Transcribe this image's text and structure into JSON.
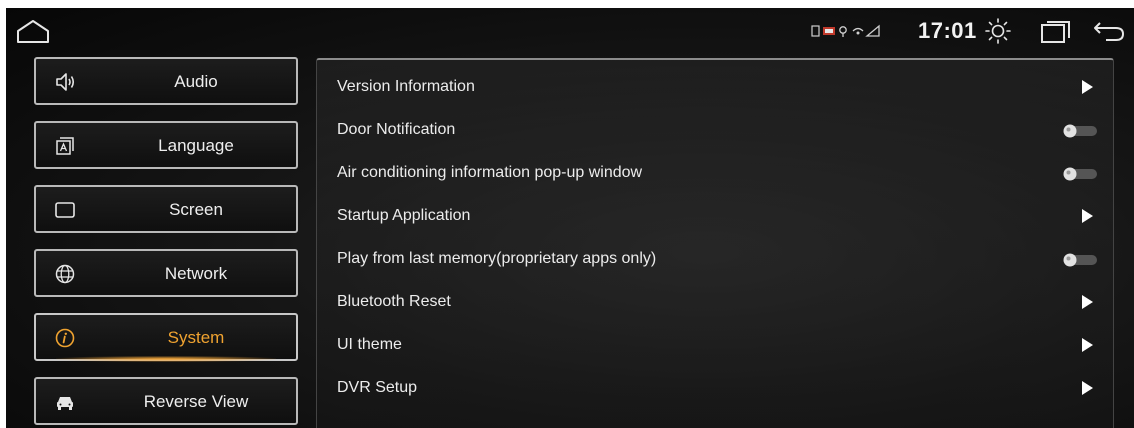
{
  "status_bar": {
    "time": "17:01",
    "icons": [
      "home-icon",
      "sd-card-icon",
      "usb-icon",
      "location-icon",
      "signal-icon",
      "brightness-icon",
      "recent-apps-icon",
      "back-icon"
    ]
  },
  "sidebar": {
    "items": [
      {
        "label": "Audio",
        "icon": "speaker-icon",
        "active": false
      },
      {
        "label": "Language",
        "icon": "language-icon",
        "active": false
      },
      {
        "label": "Screen",
        "icon": "screen-icon",
        "active": false
      },
      {
        "label": "Network",
        "icon": "globe-icon",
        "active": false
      },
      {
        "label": "System",
        "icon": "info-icon",
        "active": true
      },
      {
        "label": "Reverse View",
        "icon": "car-icon",
        "active": false
      }
    ]
  },
  "settings": {
    "rows": [
      {
        "label": "Version Information",
        "control": "arrow"
      },
      {
        "label": "Door Notification",
        "control": "toggle",
        "on": false
      },
      {
        "label": "Air conditioning information pop-up window",
        "control": "toggle",
        "on": false
      },
      {
        "label": "Startup Application",
        "control": "arrow"
      },
      {
        "label": "Play from last memory(proprietary apps only)",
        "control": "toggle",
        "on": false
      },
      {
        "label": "Bluetooth Reset",
        "control": "arrow"
      },
      {
        "label": "UI theme",
        "control": "arrow"
      },
      {
        "label": "DVR Setup",
        "control": "arrow"
      }
    ]
  },
  "colors": {
    "accent": "#f0a330",
    "background": "#0d0d0d",
    "border": "#b9b9b9",
    "text": "#ececec"
  }
}
